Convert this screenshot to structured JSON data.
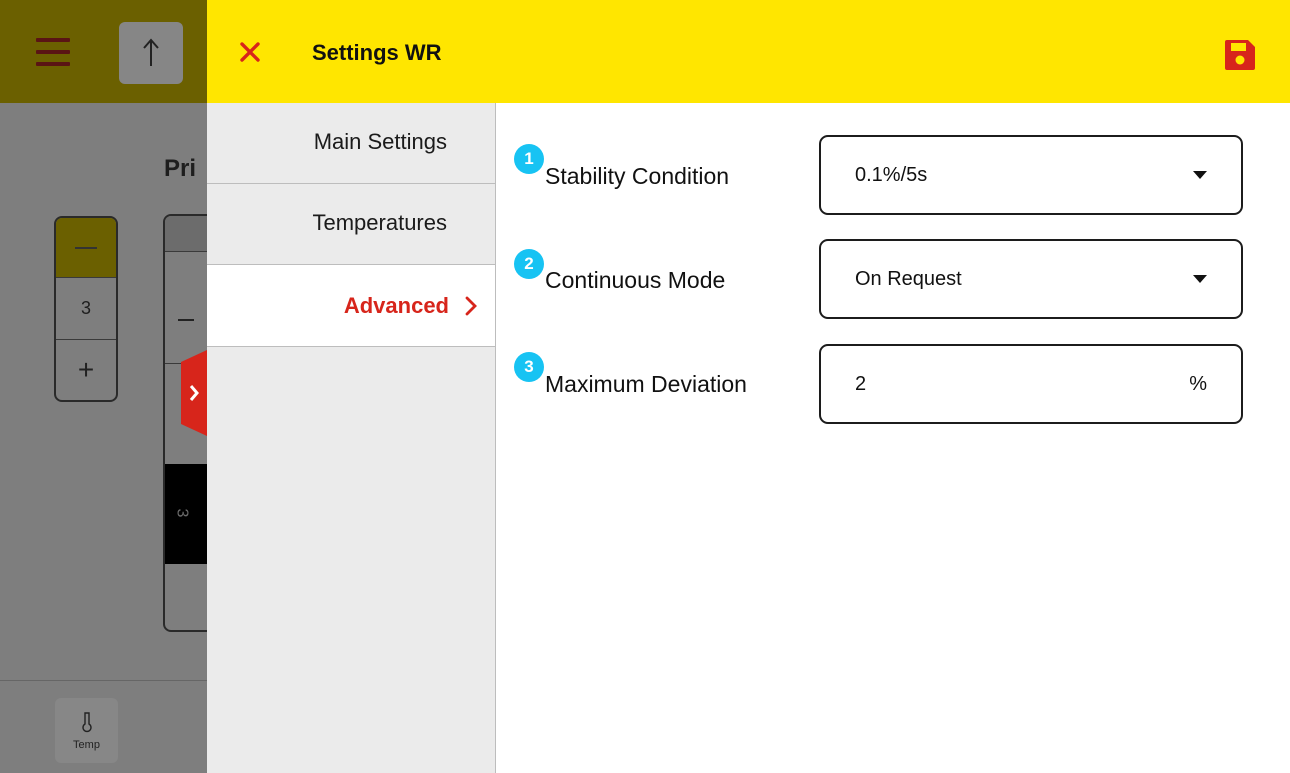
{
  "background": {
    "partial_title": "Pri",
    "stepper_value": "3",
    "segment_value": "3",
    "temp_button_label": "Temp"
  },
  "panel": {
    "title": "Settings WR",
    "nav": [
      {
        "label": "Main Settings"
      },
      {
        "label": "Temperatures"
      },
      {
        "label": "Advanced"
      }
    ],
    "fields": [
      {
        "number": "1",
        "label": "Stability Condition",
        "value": "0.1%/5s"
      },
      {
        "number": "2",
        "label": "Continuous Mode",
        "value": "On Request"
      },
      {
        "number": "3",
        "label": "Maximum Deviation",
        "value": "2",
        "unit": "%"
      }
    ]
  },
  "colors": {
    "header_yellow": "#ffe600",
    "accent_red": "#d7251b",
    "badge_blue": "#17c3f3"
  },
  "icons": {
    "close": "close-icon",
    "save": "save-icon",
    "menu": "hamburger-icon",
    "up": "arrow-up-icon",
    "thermometer": "thermometer-icon",
    "chevron": "chevron-right-icon"
  }
}
